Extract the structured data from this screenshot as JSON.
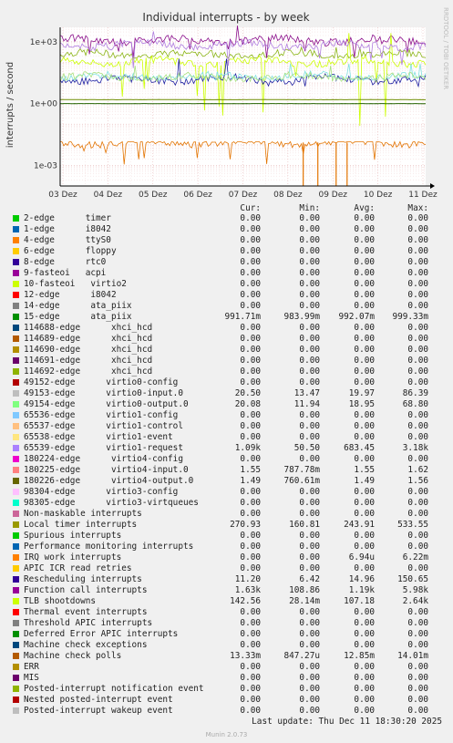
{
  "chart_data": {
    "type": "line",
    "title": "Individual interrupts - by week",
    "ylabel": "interrupts / second",
    "yscale": "log",
    "ylim": [
      0.0001,
      5000
    ],
    "yticks": [
      "1e-03",
      "1e+00",
      "1e+03"
    ],
    "x": [
      "03 Dez",
      "04 Dez",
      "05 Dez",
      "06 Dez",
      "07 Dez",
      "08 Dez",
      "09 Dez",
      "10 Dez",
      "11 Dez"
    ],
    "watermark": "RRDTOOL / TOBI OETIKER",
    "series": [
      {
        "name": "Local timer interrupts",
        "color": "#8AB414",
        "avg": 243.91,
        "min": 160.81,
        "max": 533.55
      },
      {
        "name": "Function call interrupts",
        "color": "#8A0E8A",
        "avg": 1190,
        "min": 108.86,
        "max": 5980
      },
      {
        "name": "TLB shootdowns",
        "color": "#CCFF00",
        "avg": 107.18,
        "min": 0.0281,
        "max": 2640
      },
      {
        "name": "65539-edge virtio1-request",
        "color": "#B07EE0",
        "avg": 683.45,
        "min": 50.5,
        "max": 3180
      },
      {
        "name": "Rescheduling interrupts",
        "color": "#1E1EA0",
        "avg": 14.96,
        "min": 6.42,
        "max": 150.65
      },
      {
        "name": "49153-edge virtio0-input.0",
        "color": "#7EE0E0",
        "avg": 19.97,
        "min": 13.47,
        "max": 86.39
      },
      {
        "name": "49154-edge virtio0-output.0",
        "color": "#A8E07E",
        "avg": 18.95,
        "min": 11.94,
        "max": 68.8
      },
      {
        "name": "15-edge ata_piix",
        "color": "#246400",
        "avg": 0.99207,
        "min": 0.98399,
        "max": 0.99933
      },
      {
        "name": "180225-edge virtio4-input.0",
        "color": "#6E8C00",
        "avg": 1.55,
        "min": 0.78778,
        "max": 1.62
      },
      {
        "name": "Machine check polls",
        "color": "#E37400",
        "avg": 0.01285,
        "min": 0.000847,
        "max": 0.01401
      }
    ]
  },
  "legend": {
    "headers": {
      "cur": "Cur:",
      "min": "Min:",
      "avg": "Avg:",
      "max": "Max:"
    },
    "rows": [
      {
        "name": "2-edge      timer",
        "color": "#00CC00",
        "cur": "0.00",
        "min": "0.00",
        "avg": "0.00",
        "max": "0.00"
      },
      {
        "name": "1-edge      i8042",
        "color": "#0066B3",
        "cur": "0.00",
        "min": "0.00",
        "avg": "0.00",
        "max": "0.00"
      },
      {
        "name": "4-edge      ttyS0",
        "color": "#FF8000",
        "cur": "0.00",
        "min": "0.00",
        "avg": "0.00",
        "max": "0.00"
      },
      {
        "name": "6-edge      floppy",
        "color": "#FFCC00",
        "cur": "0.00",
        "min": "0.00",
        "avg": "0.00",
        "max": "0.00"
      },
      {
        "name": "8-edge      rtc0",
        "color": "#330099",
        "cur": "0.00",
        "min": "0.00",
        "avg": "0.00",
        "max": "0.00"
      },
      {
        "name": "9-fasteoi   acpi",
        "color": "#990099",
        "cur": "0.00",
        "min": "0.00",
        "avg": "0.00",
        "max": "0.00"
      },
      {
        "name": "10-fasteoi   virtio2",
        "color": "#CCFF00",
        "cur": "0.00",
        "min": "0.00",
        "avg": "0.00",
        "max": "0.00"
      },
      {
        "name": "12-edge      i8042",
        "color": "#FF0000",
        "cur": "0.00",
        "min": "0.00",
        "avg": "0.00",
        "max": "0.00"
      },
      {
        "name": "14-edge      ata_piix",
        "color": "#808080",
        "cur": "0.00",
        "min": "0.00",
        "avg": "0.00",
        "max": "0.00"
      },
      {
        "name": "15-edge      ata_piix",
        "color": "#008F00",
        "cur": "991.71m",
        "min": "983.99m",
        "avg": "992.07m",
        "max": "999.33m"
      },
      {
        "name": "114688-edge      xhci_hcd",
        "color": "#00487D",
        "cur": "0.00",
        "min": "0.00",
        "avg": "0.00",
        "max": "0.00"
      },
      {
        "name": "114689-edge      xhci_hcd",
        "color": "#B35A00",
        "cur": "0.00",
        "min": "0.00",
        "avg": "0.00",
        "max": "0.00"
      },
      {
        "name": "114690-edge      xhci_hcd",
        "color": "#B38F00",
        "cur": "0.00",
        "min": "0.00",
        "avg": "0.00",
        "max": "0.00"
      },
      {
        "name": "114691-edge      xhci_hcd",
        "color": "#6B006B",
        "cur": "0.00",
        "min": "0.00",
        "avg": "0.00",
        "max": "0.00"
      },
      {
        "name": "114692-edge      xhci_hcd",
        "color": "#8FB300",
        "cur": "0.00",
        "min": "0.00",
        "avg": "0.00",
        "max": "0.00"
      },
      {
        "name": "49152-edge      virtio0-config",
        "color": "#B30000",
        "cur": "0.00",
        "min": "0.00",
        "avg": "0.00",
        "max": "0.00"
      },
      {
        "name": "49153-edge      virtio0-input.0",
        "color": "#BEBEBE",
        "cur": "20.50",
        "min": "13.47",
        "avg": "19.97",
        "max": "86.39"
      },
      {
        "name": "49154-edge      virtio0-output.0",
        "color": "#80FF80",
        "cur": "20.08",
        "min": "11.94",
        "avg": "18.95",
        "max": "68.80"
      },
      {
        "name": "65536-edge      virtio1-config",
        "color": "#80C9FF",
        "cur": "0.00",
        "min": "0.00",
        "avg": "0.00",
        "max": "0.00"
      },
      {
        "name": "65537-edge      virtio1-control",
        "color": "#FFC080",
        "cur": "0.00",
        "min": "0.00",
        "avg": "0.00",
        "max": "0.00"
      },
      {
        "name": "65538-edge      virtio1-event",
        "color": "#FFE680",
        "cur": "0.00",
        "min": "0.00",
        "avg": "0.00",
        "max": "0.00"
      },
      {
        "name": "65539-edge      virtio1-request",
        "color": "#AA80FF",
        "cur": "1.09k",
        "min": "50.50",
        "avg": "683.45",
        "max": "3.18k"
      },
      {
        "name": "180224-edge      virtio4-config",
        "color": "#EE00CC",
        "cur": "0.00",
        "min": "0.00",
        "avg": "0.00",
        "max": "0.00"
      },
      {
        "name": "180225-edge      virtio4-input.0",
        "color": "#FF8080",
        "cur": "1.55",
        "min": "787.78m",
        "avg": "1.55",
        "max": "1.62"
      },
      {
        "name": "180226-edge      virtio4-output.0",
        "color": "#666600",
        "cur": "1.49",
        "min": "760.61m",
        "avg": "1.49",
        "max": "1.56"
      },
      {
        "name": "98304-edge      virtio3-config",
        "color": "#FFBFFF",
        "cur": "0.00",
        "min": "0.00",
        "avg": "0.00",
        "max": "0.00"
      },
      {
        "name": "98305-edge      virtio3-virtqueues",
        "color": "#00FFCC",
        "cur": "0.00",
        "min": "0.00",
        "avg": "0.00",
        "max": "0.00"
      },
      {
        "name": "Non-maskable interrupts",
        "color": "#CC6699",
        "cur": "0.00",
        "min": "0.00",
        "avg": "0.00",
        "max": "0.00"
      },
      {
        "name": "Local timer interrupts",
        "color": "#999900",
        "cur": "270.93",
        "min": "160.81",
        "avg": "243.91",
        "max": "533.55"
      },
      {
        "name": "Spurious interrupts",
        "color": "#00CC00",
        "cur": "0.00",
        "min": "0.00",
        "avg": "0.00",
        "max": "0.00"
      },
      {
        "name": "Performance monitoring interrupts",
        "color": "#0066B3",
        "cur": "0.00",
        "min": "0.00",
        "avg": "0.00",
        "max": "0.00"
      },
      {
        "name": "IRQ work interrupts",
        "color": "#FF8000",
        "cur": "0.00",
        "min": "0.00",
        "avg": "6.94u",
        "max": "6.22m"
      },
      {
        "name": "APIC ICR read retries",
        "color": "#FFCC00",
        "cur": "0.00",
        "min": "0.00",
        "avg": "0.00",
        "max": "0.00"
      },
      {
        "name": "Rescheduling interrupts",
        "color": "#330099",
        "cur": "11.20",
        "min": "6.42",
        "avg": "14.96",
        "max": "150.65"
      },
      {
        "name": "Function call interrupts",
        "color": "#990099",
        "cur": "1.63k",
        "min": "108.86",
        "avg": "1.19k",
        "max": "5.98k"
      },
      {
        "name": "TLB shootdowns",
        "color": "#CCFF00",
        "cur": "142.56",
        "min": "28.14m",
        "avg": "107.18",
        "max": "2.64k"
      },
      {
        "name": "Thermal event interrupts",
        "color": "#FF0000",
        "cur": "0.00",
        "min": "0.00",
        "avg": "0.00",
        "max": "0.00"
      },
      {
        "name": "Threshold APIC interrupts",
        "color": "#808080",
        "cur": "0.00",
        "min": "0.00",
        "avg": "0.00",
        "max": "0.00"
      },
      {
        "name": "Deferred Error APIC interrupts",
        "color": "#008F00",
        "cur": "0.00",
        "min": "0.00",
        "avg": "0.00",
        "max": "0.00"
      },
      {
        "name": "Machine check exceptions",
        "color": "#00487D",
        "cur": "0.00",
        "min": "0.00",
        "avg": "0.00",
        "max": "0.00"
      },
      {
        "name": "Machine check polls",
        "color": "#B35A00",
        "cur": "13.33m",
        "min": "847.27u",
        "avg": "12.85m",
        "max": "14.01m"
      },
      {
        "name": "ERR",
        "color": "#B38F00",
        "cur": "0.00",
        "min": "0.00",
        "avg": "0.00",
        "max": "0.00"
      },
      {
        "name": "MIS",
        "color": "#6B006B",
        "cur": "0.00",
        "min": "0.00",
        "avg": "0.00",
        "max": "0.00"
      },
      {
        "name": "Posted-interrupt notification event",
        "color": "#8FB300",
        "cur": "0.00",
        "min": "0.00",
        "avg": "0.00",
        "max": "0.00"
      },
      {
        "name": "Nested posted-interrupt event",
        "color": "#B30000",
        "cur": "0.00",
        "min": "0.00",
        "avg": "0.00",
        "max": "0.00"
      },
      {
        "name": "Posted-interrupt wakeup event",
        "color": "#BEBEBE",
        "cur": "0.00",
        "min": "0.00",
        "avg": "0.00",
        "max": "0.00"
      }
    ]
  },
  "footer": {
    "last_update": "Last update: Thu Dec 11 18:30:20 2025",
    "munin_version": "Munin 2.0.73"
  }
}
